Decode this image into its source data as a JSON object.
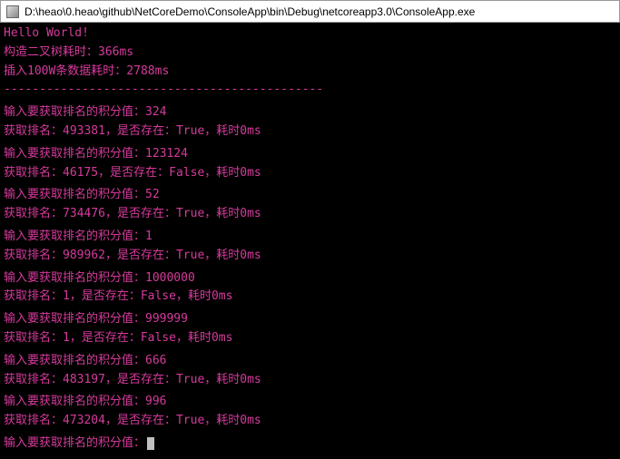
{
  "titlebar": {
    "path": "D:\\heao\\0.heao\\github\\NetCoreDemo\\ConsoleApp\\bin\\Debug\\netcoreapp3.0\\ConsoleApp.exe"
  },
  "header": {
    "hello": "Hello World!",
    "build_time": "构造二叉树耗时：366ms",
    "insert_time": "插入100W条数据耗时：2788ms",
    "separator": "---------------------------------------------"
  },
  "queries": [
    {
      "prompt": "输入要获取排名的积分值：324",
      "result": "获取排名：493381，是否存在：True，耗时0ms"
    },
    {
      "prompt": "输入要获取排名的积分值：123124",
      "result": "获取排名：46175，是否存在：False，耗时0ms"
    },
    {
      "prompt": "输入要获取排名的积分值：52",
      "result": "获取排名：734476，是否存在：True，耗时0ms"
    },
    {
      "prompt": "输入要获取排名的积分值：1",
      "result": "获取排名：989962，是否存在：True，耗时0ms"
    },
    {
      "prompt": "输入要获取排名的积分值：1000000",
      "result": "获取排名：1，是否存在：False，耗时0ms"
    },
    {
      "prompt": "输入要获取排名的积分值：999999",
      "result": "获取排名：1，是否存在：False，耗时0ms"
    },
    {
      "prompt": "输入要获取排名的积分值：666",
      "result": "获取排名：483197，是否存在：True，耗时0ms"
    },
    {
      "prompt": "输入要获取排名的积分值：996",
      "result": "获取排名：473204，是否存在：True，耗时0ms"
    }
  ],
  "current_prompt": "输入要获取排名的积分值："
}
